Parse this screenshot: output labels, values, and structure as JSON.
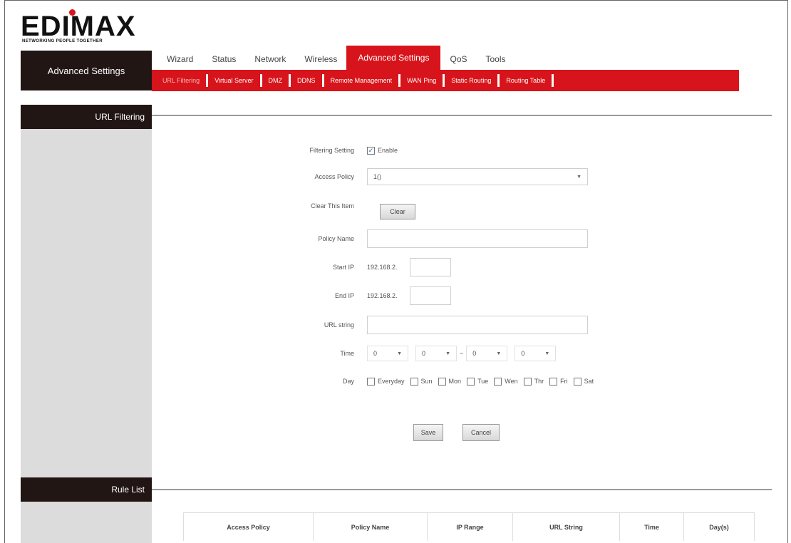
{
  "brand": {
    "logo_text": "EDIMAX",
    "tagline": "NETWORKING PEOPLE TOGETHER"
  },
  "sidebar": {
    "section_title": "Advanced Settings",
    "url_filtering_label": "URL Filtering",
    "rule_list_label": "Rule List"
  },
  "main_tabs": [
    {
      "label": "Wizard",
      "active": false
    },
    {
      "label": "Status",
      "active": false
    },
    {
      "label": "Network",
      "active": false
    },
    {
      "label": "Wireless",
      "active": false
    },
    {
      "label": "Advanced Settings",
      "active": true
    },
    {
      "label": "QoS",
      "active": false
    },
    {
      "label": "Tools",
      "active": false
    }
  ],
  "sub_tabs": [
    {
      "label": "URL Filtering",
      "active": true
    },
    {
      "label": "Virtual Server",
      "active": false
    },
    {
      "label": "DMZ",
      "active": false
    },
    {
      "label": "DDNS",
      "active": false
    },
    {
      "label": "Remote Management",
      "active": false
    },
    {
      "label": "WAN Ping",
      "active": false
    },
    {
      "label": "Static Routing",
      "active": false
    },
    {
      "label": "Routing Table",
      "active": false
    }
  ],
  "form": {
    "filtering_setting_label": "Filtering Setting",
    "enable_label": "Enable",
    "enable_checked": true,
    "access_policy_label": "Access Policy",
    "access_policy_value": "1()",
    "clear_item_label": "Clear This Item",
    "clear_button": "Clear",
    "policy_name_label": "Policy Name",
    "policy_name_value": "",
    "start_ip_label": "Start IP",
    "start_ip_prefix": "192.168.2.",
    "start_ip_value": "",
    "end_ip_label": "End IP",
    "end_ip_prefix": "192.168.2.",
    "end_ip_value": "",
    "url_string_label": "URL string",
    "url_string_value": "",
    "time_label": "Time",
    "time_values": [
      "0",
      "0",
      "0",
      "0"
    ],
    "time_separator": "~",
    "day_label": "Day",
    "days": [
      "Everyday",
      "Sun",
      "Mon",
      "Tue",
      "Wen",
      "Thr",
      "Fri",
      "Sat"
    ],
    "save_button": "Save",
    "cancel_button": "Cancel"
  },
  "rule_table": {
    "columns": [
      "Access Policy",
      "Policy Name",
      "IP Range",
      "URL String",
      "Time",
      "Day(s)"
    ]
  }
}
